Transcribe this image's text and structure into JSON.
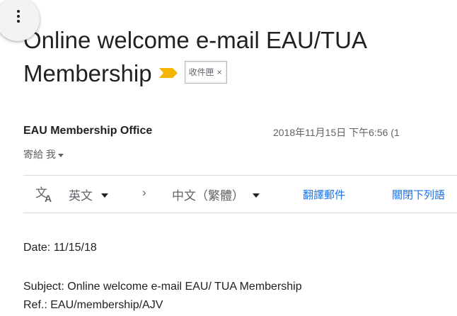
{
  "header": {
    "subject_line1": "Online welcome e-mail EAU/TUA",
    "subject_line2": "Membership",
    "label_chip": "收件匣",
    "label_chip_remove": "×",
    "importance_color": "#f4b400"
  },
  "message": {
    "sender": "EAU Membership Office",
    "date": "2018年11月15日 下午6:56 (1",
    "recipient_label": "寄給 我"
  },
  "translate": {
    "icon": "translate-icon",
    "source_lang": "英文",
    "arrow": "›",
    "target_lang": "中文（繁體）",
    "translate_link": "翻譯郵件",
    "close_link": "關閉下列語"
  },
  "body": {
    "date_line": "Date: 11/15/18",
    "subject_line": "Subject: Online welcome e-mail EAU/ TUA Membership",
    "ref_line": "Ref.: EAU/membership/AJV"
  },
  "colors": {
    "link": "#1a73e8",
    "secondary_text": "#5f6368"
  }
}
